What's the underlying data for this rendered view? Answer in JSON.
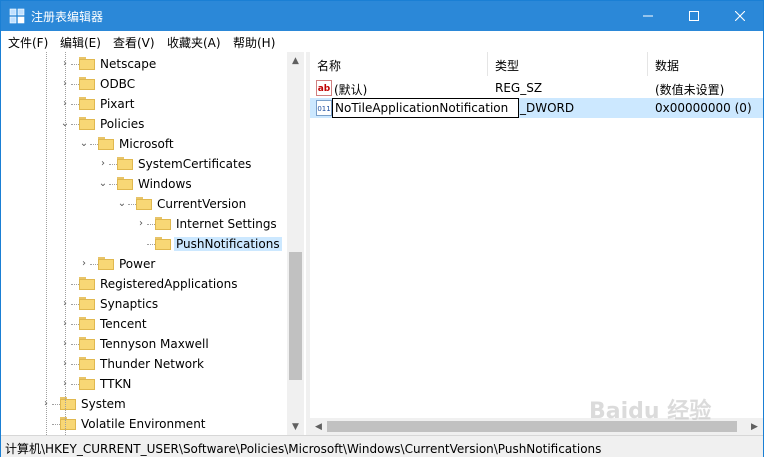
{
  "window": {
    "title": "注册表编辑器"
  },
  "menu": [
    "文件(F)",
    "编辑(E)",
    "查看(V)",
    "收藏夹(A)",
    "帮助(H)"
  ],
  "tree": [
    {
      "label": "Netscape",
      "depth": 2,
      "arrow": "›"
    },
    {
      "label": "ODBC",
      "depth": 2,
      "arrow": "›"
    },
    {
      "label": "Pixart",
      "depth": 2,
      "arrow": "›"
    },
    {
      "label": "Policies",
      "depth": 2,
      "arrow": "⌄"
    },
    {
      "label": "Microsoft",
      "depth": 3,
      "arrow": "⌄"
    },
    {
      "label": "SystemCertificates",
      "depth": 4,
      "arrow": "›"
    },
    {
      "label": "Windows",
      "depth": 4,
      "arrow": "⌄"
    },
    {
      "label": "CurrentVersion",
      "depth": 5,
      "arrow": "⌄"
    },
    {
      "label": "Internet Settings",
      "depth": 6,
      "arrow": "›"
    },
    {
      "label": "PushNotifications",
      "depth": 6,
      "arrow": "",
      "selected": true
    },
    {
      "label": "Power",
      "depth": 3,
      "arrow": "›"
    },
    {
      "label": "RegisteredApplications",
      "depth": 2,
      "arrow": ""
    },
    {
      "label": "Synaptics",
      "depth": 2,
      "arrow": "›"
    },
    {
      "label": "Tencent",
      "depth": 2,
      "arrow": "›"
    },
    {
      "label": "Tennyson Maxwell",
      "depth": 2,
      "arrow": "›"
    },
    {
      "label": "Thunder Network",
      "depth": 2,
      "arrow": "›"
    },
    {
      "label": "TTKN",
      "depth": 2,
      "arrow": "›"
    },
    {
      "label": "System",
      "depth": 1,
      "arrow": "›"
    },
    {
      "label": "Volatile Environment",
      "depth": 1,
      "arrow": ""
    }
  ],
  "list": {
    "columns": {
      "name": "名称",
      "type": "类型",
      "data": "数据"
    },
    "rows": [
      {
        "icon": "ab",
        "name": "(默认)",
        "type": "REG_SZ",
        "data": "(数值未设置)"
      },
      {
        "icon": "011",
        "name": "NoTileApplicationNotification",
        "type": "_DWORD",
        "data": "0x00000000 (0)",
        "editing": true
      }
    ]
  },
  "statusbar": {
    "path": "计算机\\HKEY_CURRENT_USER\\Software\\Policies\\Microsoft\\Windows\\CurrentVersion\\PushNotifications"
  },
  "watermark": "Baidu 经验",
  "colors": {
    "titlebar": "#2b88d8",
    "selection": "#cce8ff",
    "folder": "#f8d775"
  }
}
